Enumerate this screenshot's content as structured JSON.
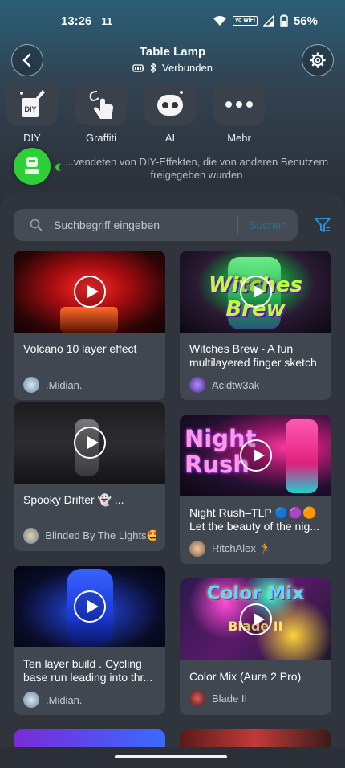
{
  "status": {
    "time": "13:26",
    "notification": "11",
    "wifi_tag": "Vo WiFi",
    "battery": "56%"
  },
  "header": {
    "title": "Table Lamp",
    "connection": "Verbunden"
  },
  "categories": [
    {
      "label": "DIY",
      "icon": "diy-icon"
    },
    {
      "label": "Graffiti",
      "icon": "hand-draw-icon"
    },
    {
      "label": "AI",
      "icon": "robot-icon"
    },
    {
      "label": "Mehr",
      "icon": "more-dots-icon"
    }
  ],
  "info_text": "...vendeten von DIY-Effekten, die von anderen Benutzern freigegeben wurden",
  "search": {
    "placeholder": "Suchbegriff eingeben",
    "button": "Suchen"
  },
  "cards": [
    {
      "title": "Volcano 10 layer effect",
      "author": ".Midian."
    },
    {
      "title": "Witches Brew - A fun multilayered finger sketch",
      "author": "Acidtw3ak",
      "thumb_text": "Witches Brew"
    },
    {
      "title": "Spooky Drifter 👻 ...",
      "author": "Blinded By The Lights🤩"
    },
    {
      "title": "Night Rush–TLP 🔵🟣🟠 Let the beauty of the nig...",
      "author": "RitchAlex 🏃",
      "thumb_text_1": "Night",
      "thumb_text_2": "Rush"
    },
    {
      "title": "Ten layer build . Cycling base run leading into thr...",
      "author": ".Midian."
    },
    {
      "title": "Color Mix (Aura 2 Pro)",
      "author": "Blade II",
      "thumb_text_1": "Color Mix",
      "thumb_text_2": "Blade II"
    }
  ],
  "colors": {
    "accent_green": "#2fcf3a",
    "accent_blue": "#2b8fd8",
    "card_bg": "#414750"
  }
}
